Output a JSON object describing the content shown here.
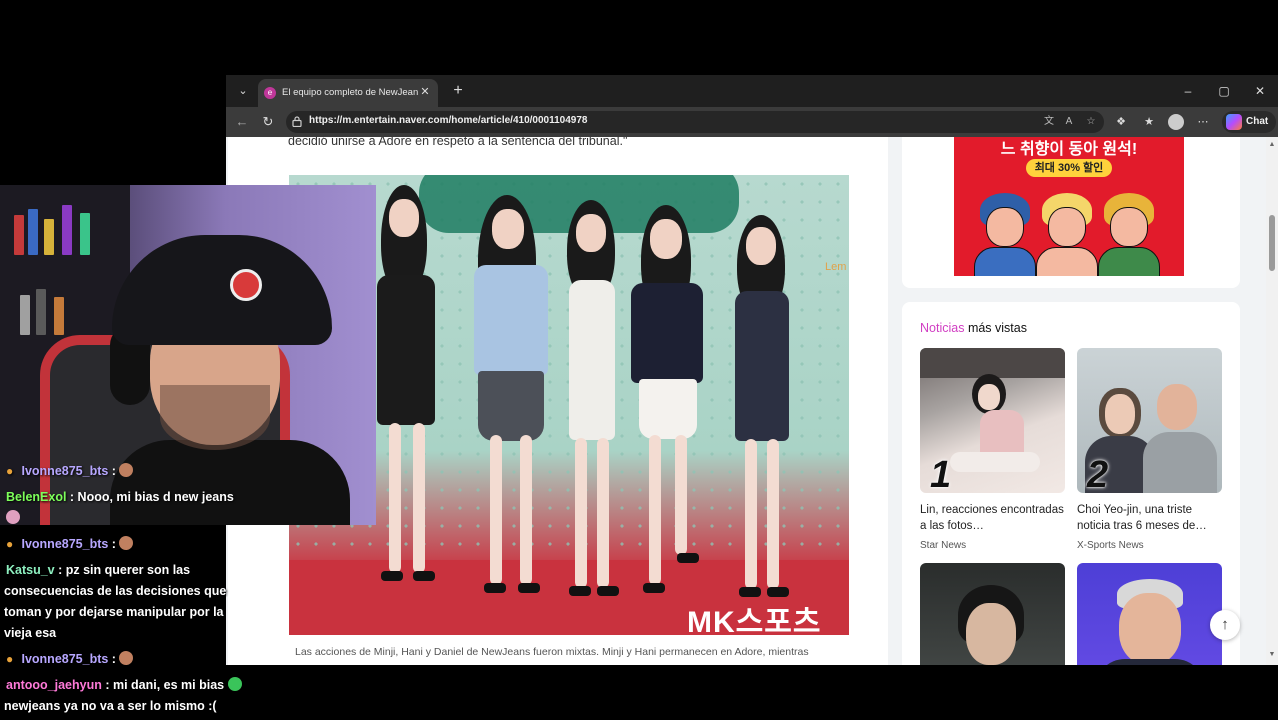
{
  "browser": {
    "tab": {
      "title": "El equipo completo de NewJeans"
    },
    "url": "https://m.entertain.naver.com/home/article/410/0001104978",
    "chat_label": "Chat",
    "window_controls": {
      "minimize": "–",
      "restore": "▢",
      "close": "✕"
    }
  },
  "article": {
    "quote": "decidió unirse a Adore en respeto a la sentencia del tribunal.\"",
    "photo_watermark": "MK스포츠",
    "side_mark": "Lem",
    "caption": "Las acciones de Minji, Hani y Daniel de NewJeans fueron mixtas. Minji y Hani permanecen en Adore, mientras"
  },
  "sidebar": {
    "ad": {
      "headline": "느 취향이 동아 원석!",
      "badge": "최대 30% 할인"
    },
    "news": {
      "title_highlight": "Noticias",
      "title_rest": " más vistas",
      "items": [
        {
          "rank": "1",
          "text": "Lin, reacciones encontradas a las fotos…",
          "source": "Star News"
        },
        {
          "rank": "2",
          "text": "Choi Yeo-jin, una triste noticia tras 6 meses de…",
          "source": "X-Sports News"
        }
      ]
    }
  },
  "chat": {
    "messages": [
      {
        "user": "Ivonne875_bts",
        "sep": " : ",
        "text": "",
        "user_color": "#b7a7ff"
      },
      {
        "user": "BelenExol",
        "sep": " : ",
        "text": "Nooo, mi bias d new jeans",
        "user_color": "#7dff5a"
      },
      {
        "user": "Ivonne875_bts",
        "sep": " : ",
        "text": "",
        "user_color": "#b7a7ff"
      },
      {
        "user": "Katsu_v",
        "sep": " : ",
        "text": "pz sin querer son las",
        "user_color": "#8ef0c0"
      },
      {
        "user": "",
        "sep": "",
        "text": "consecuencias de las decisiones que",
        "user_color": "#fff"
      },
      {
        "user": "",
        "sep": "",
        "text": "toman y por dejarse manipular por la",
        "user_color": "#fff"
      },
      {
        "user": "",
        "sep": "",
        "text": "vieja esa",
        "user_color": "#fff"
      },
      {
        "user": "Ivonne875_bts",
        "sep": " : ",
        "text": "",
        "user_color": "#b7a7ff"
      },
      {
        "user": "antooo_jaehyun",
        "sep": " : ",
        "text": "mi dani, es mi bias",
        "user_color": "#ff7ad9"
      },
      {
        "user": "",
        "sep": "",
        "text": "newjeans ya no va a ser lo mismo :(",
        "user_color": "#fff"
      }
    ]
  }
}
